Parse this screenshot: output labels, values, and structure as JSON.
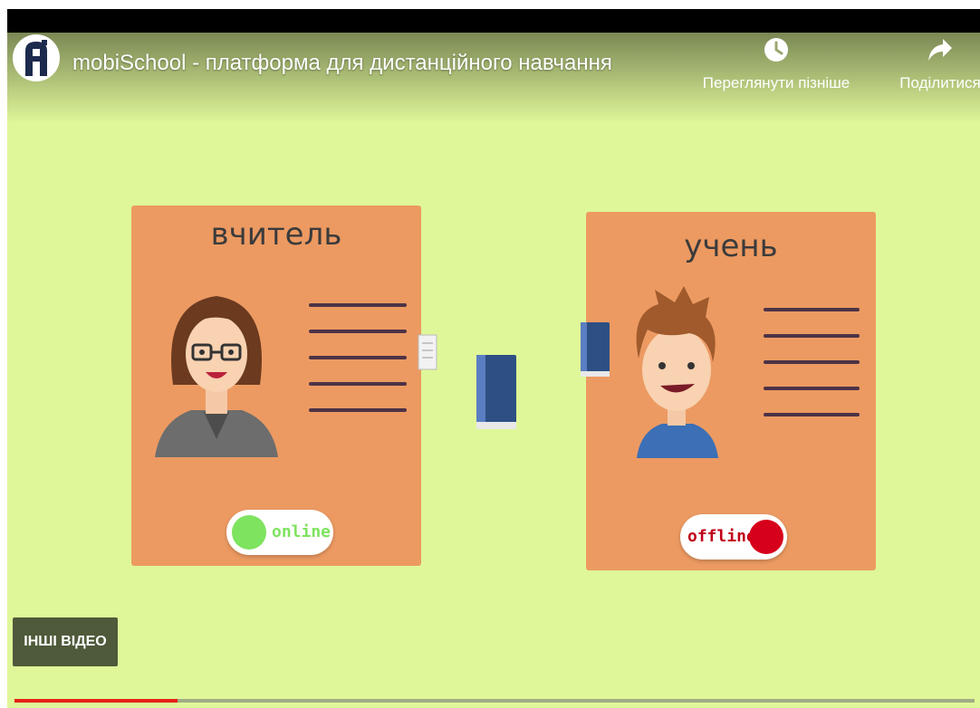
{
  "header": {
    "video_title": "mobiSchool - платформа для дистанційного навчання",
    "watch_later_label": "Переглянути пізніше",
    "share_label": "Поділитися"
  },
  "teacher_card": {
    "title": "вчитель",
    "status": "online",
    "status_color": "#7ee35f"
  },
  "student_card": {
    "title": "учень",
    "status": "offline",
    "status_color": "#d7001b"
  },
  "other_videos_label": "ІНШІ ВІДЕО",
  "progress": {
    "played_fraction": 0.17,
    "color": "#e62117"
  },
  "colors": {
    "background": "#dff799",
    "card": "#ec9a62",
    "line": "#4d3346"
  }
}
